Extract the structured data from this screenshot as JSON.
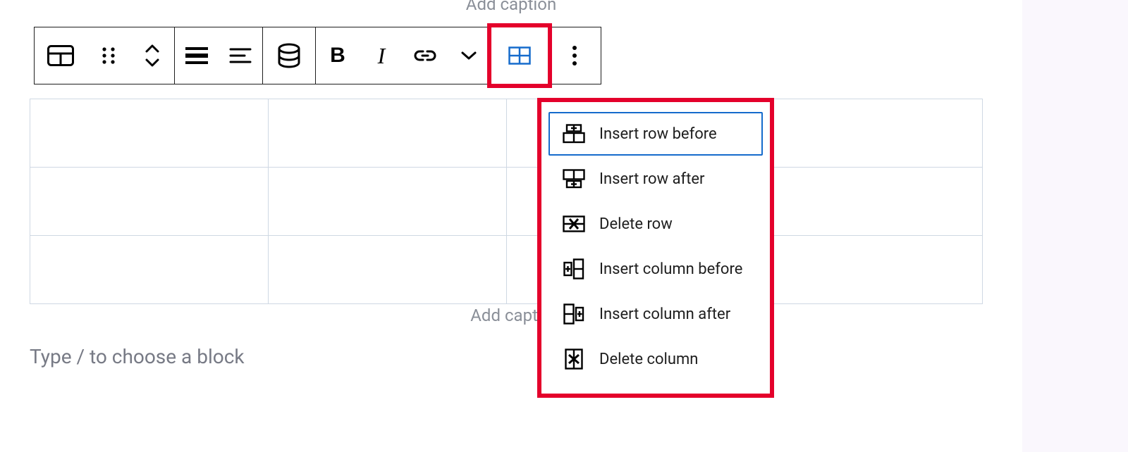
{
  "captions": {
    "top_cut": "Add caption",
    "below_table": "Add capti",
    "block_placeholder": "Type / to choose a block"
  },
  "toolbar": {
    "groups": [
      {
        "buttons": [
          "block-type",
          "drag",
          "move-updown"
        ]
      },
      {
        "buttons": [
          "align-full",
          "align-content"
        ]
      },
      {
        "buttons": [
          "styles"
        ]
      },
      {
        "buttons": [
          "bold",
          "italic",
          "link",
          "more-format"
        ]
      },
      {
        "buttons": [
          "edit-table"
        ]
      },
      {
        "buttons": [
          "options"
        ]
      }
    ]
  },
  "table": {
    "rows": 3,
    "cols": 4
  },
  "table_menu": {
    "items": [
      {
        "id": "insert-row-before",
        "label": "Insert row before",
        "highlight": true
      },
      {
        "id": "insert-row-after",
        "label": "Insert row after"
      },
      {
        "id": "delete-row",
        "label": "Delete row"
      },
      {
        "id": "insert-col-before",
        "label": "Insert column before"
      },
      {
        "id": "insert-col-after",
        "label": "Insert column after"
      },
      {
        "id": "delete-col",
        "label": "Delete column"
      }
    ]
  },
  "colors": {
    "highlight_red": "#e4002b",
    "accent_blue": "#156bcc"
  }
}
